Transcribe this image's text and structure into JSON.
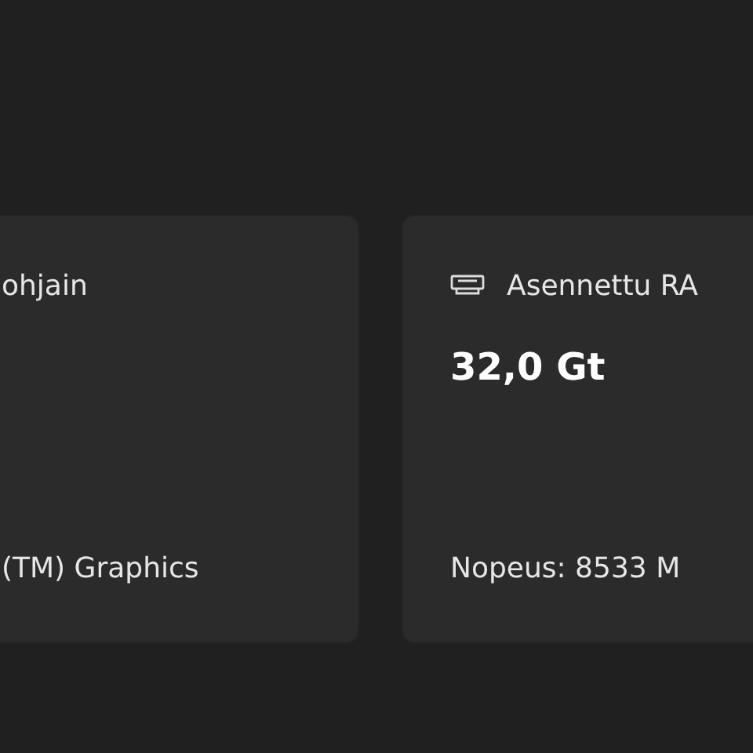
{
  "cards": [
    {
      "kind": "plain",
      "title": "ohjain",
      "footer": "(TM) Graphics"
    },
    {
      "kind": "memory",
      "title": "Asennettu RA",
      "value": "32,0 Gt",
      "footer": "Nopeus: 8533 M"
    }
  ]
}
